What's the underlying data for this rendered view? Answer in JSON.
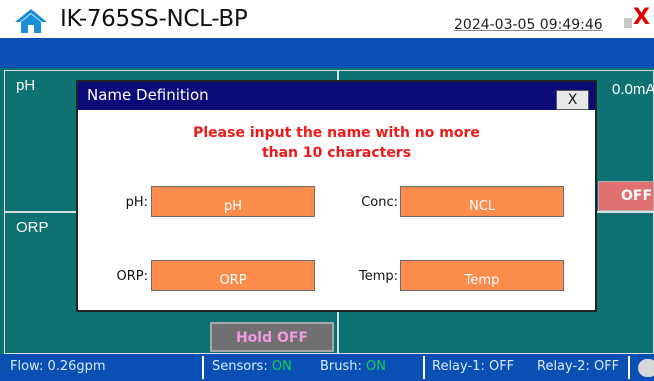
{
  "header": {
    "title": "IK-765SS-NCL-BP",
    "datetime": "2024-03-05 09:49:46",
    "close_label": "X",
    "home_icon": "home-icon"
  },
  "panels": {
    "ph_label": "pH",
    "orp_label": "ORP",
    "right_value": "0.0mA",
    "off_button": "OFF",
    "hold_button": "Hold OFF"
  },
  "dialog": {
    "title": "Name Definition",
    "close_label": "X",
    "message_line1": "Please input the name with no more",
    "message_line2": "than 10 characters",
    "fields": {
      "ph": {
        "label": "pH:",
        "value": "pH"
      },
      "conc": {
        "label": "Conc:",
        "value": "NCL"
      },
      "orp": {
        "label": "ORP:",
        "value": "ORP"
      },
      "temp": {
        "label": "Temp:",
        "value": "Temp"
      }
    }
  },
  "statusbar": {
    "flow": "Flow:  0.26gpm",
    "sensors_label": "Sensors:",
    "sensors_state": "ON",
    "brush_label": "Brush:",
    "brush_state": "ON",
    "relay1": "Relay-1: OFF",
    "relay2": "Relay-2: OFF"
  },
  "colors": {
    "panel_bg": "#0e7272",
    "bar_blue": "#0a50b4",
    "dialog_title_bg": "#0a0a78",
    "field_bg": "#fb8c4c",
    "message_red": "#f01818",
    "on_green": "#12d050"
  }
}
